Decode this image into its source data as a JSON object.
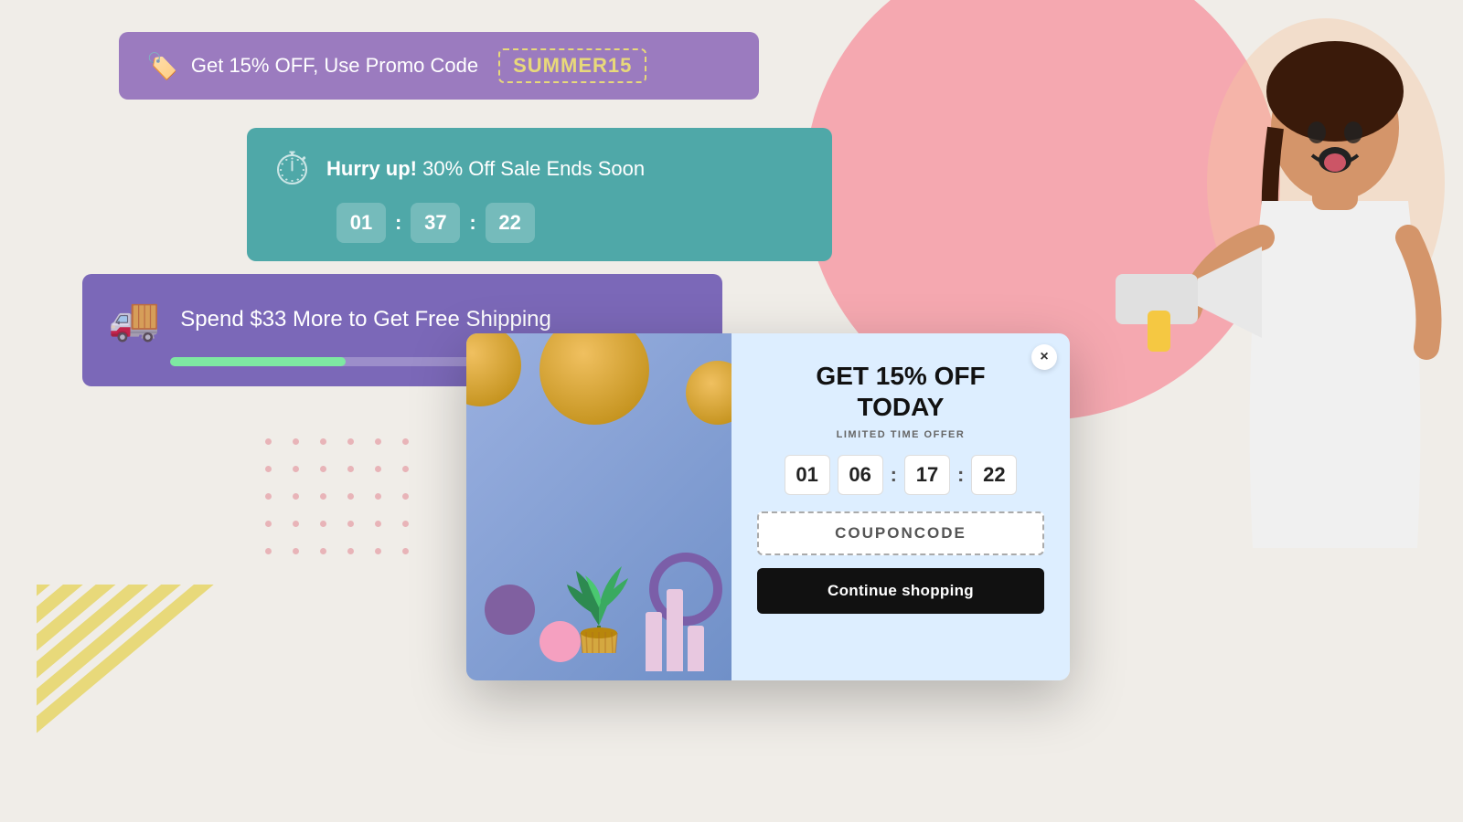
{
  "background": {
    "color": "#f0ede8"
  },
  "banner1": {
    "text": "Get 15% OFF, Use Promo Code ",
    "promo_code": "SUMMER15",
    "tag_icon": "🏷️"
  },
  "banner2": {
    "hurry_label": "Hurry up!",
    "text": " 30% Off Sale Ends Soon",
    "countdown": {
      "hours": "01",
      "minutes": "37",
      "seconds": "22"
    }
  },
  "banner3": {
    "text": "Spend $33 More to Get Free Shipping",
    "progress_percent": 35
  },
  "modal": {
    "title_line1": "GET 15% OFF",
    "title_line2": "TODAY",
    "subtitle": "LIMITED TIME OFFER",
    "countdown": {
      "hours": "01",
      "minutes1": "06",
      "minutes2": "17",
      "seconds": "22"
    },
    "coupon_code": "COUPONCODE",
    "cta_button": "Continue shopping",
    "close_label": "×"
  }
}
